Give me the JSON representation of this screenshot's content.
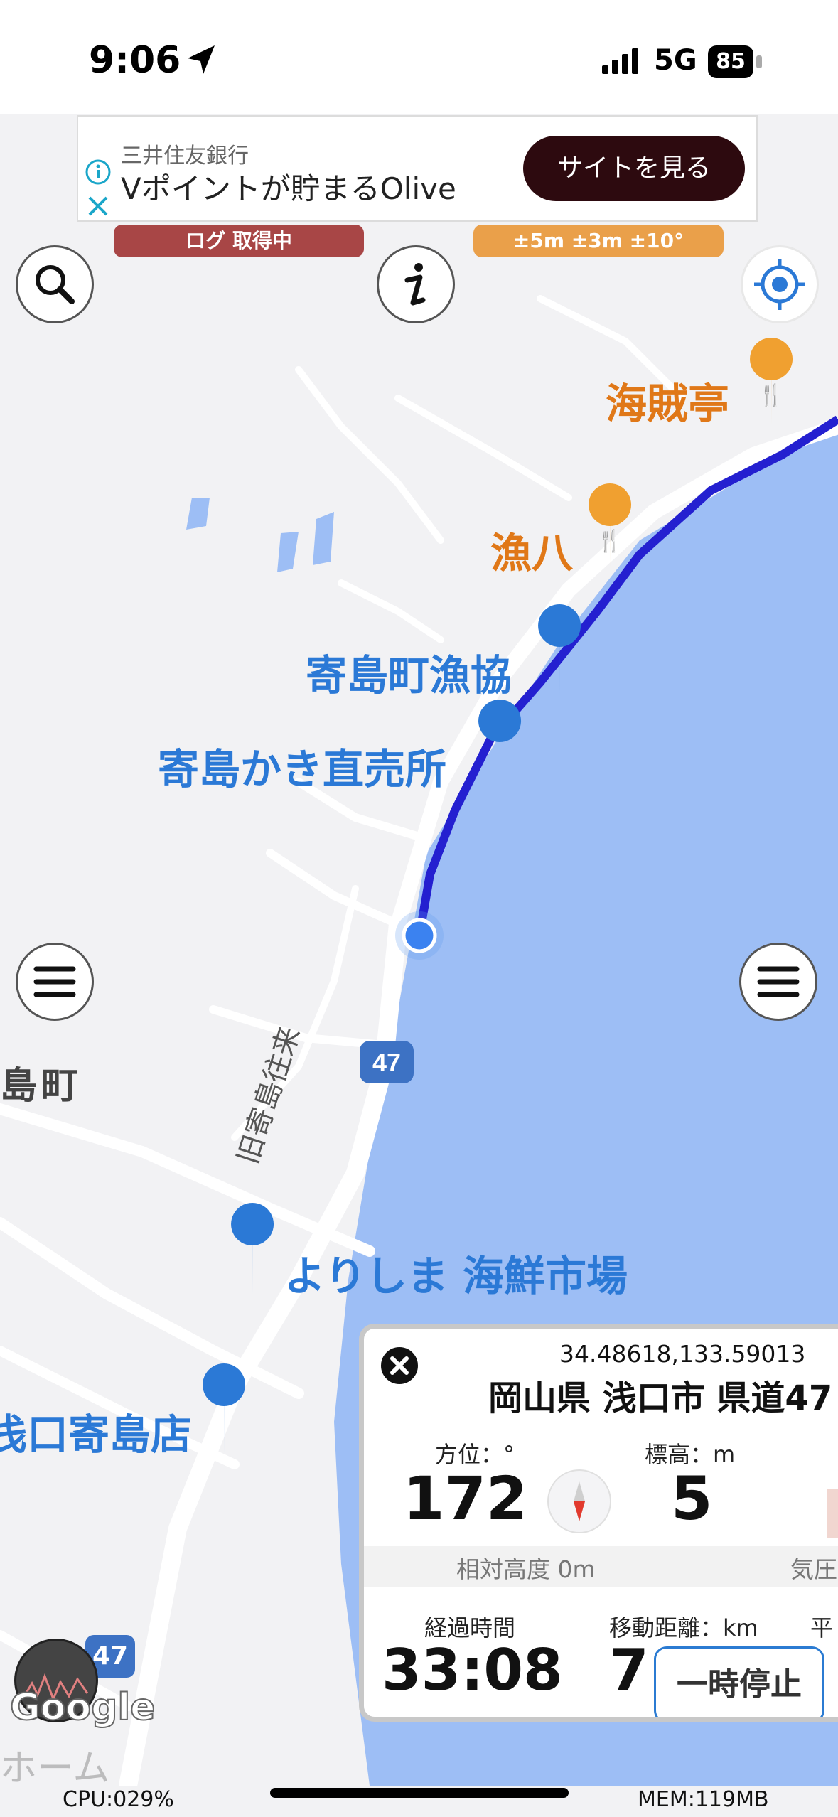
{
  "status_bar": {
    "time": "9:06",
    "network": "5G",
    "battery": "85"
  },
  "ad": {
    "sponsor": "三井住友銀行",
    "text": "Vポイントが貯まるOlive",
    "button": "サイトを見る"
  },
  "badges": {
    "log": "ログ 取得中",
    "accuracy": "±5m ±3m ±10°"
  },
  "map": {
    "pois": [
      {
        "name": "海賊亭"
      },
      {
        "name": "漁八"
      },
      {
        "name": "寄島町漁協"
      },
      {
        "name": "寄島かき直売所"
      },
      {
        "name": "よりしま 海鮮市場"
      },
      {
        "name": "浅口寄島店"
      }
    ],
    "town_label": "寄島町",
    "town_label_visible": "島町",
    "road_name": "旧寄島往来",
    "route_shield": "47",
    "route_shield_bottom": "47",
    "faded_label": "ホーム",
    "colors": {
      "water": "#9dbef5",
      "route": "#2420d0",
      "poi_orange": "#e07818",
      "poi_blue": "#2b79d6"
    }
  },
  "panel": {
    "coordinates": "34.48618,133.59013",
    "address": "岡山県 浅口市 県道47",
    "heading_label": "方位：°",
    "heading_value": "172",
    "altitude_label": "標高：m",
    "altitude_value": "5",
    "relative_altitude": "相対高度 0m",
    "pressure_label": "気圧",
    "elapsed_label": "経過時間",
    "elapsed_value": "33:08",
    "distance_label": "移動距離：km",
    "distance_value": "7",
    "avg_label": "平",
    "pause_button": "一時停止"
  },
  "footer": {
    "cpu": "CPU:029%",
    "mem": "MEM:119MB",
    "google": "Google"
  }
}
